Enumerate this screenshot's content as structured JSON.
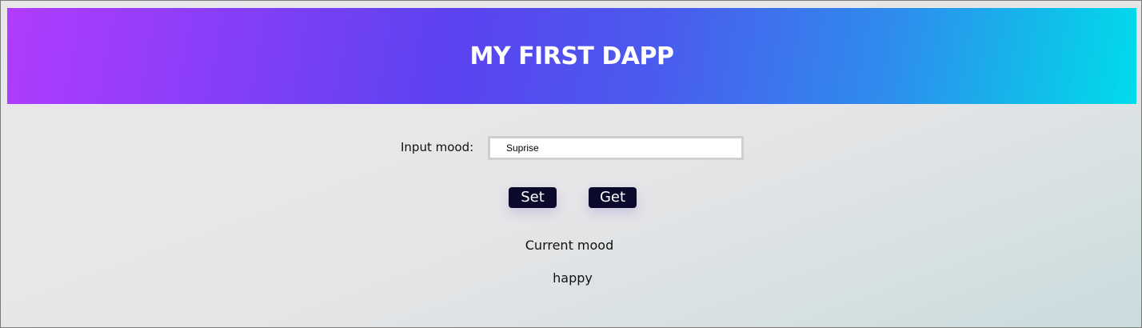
{
  "header": {
    "title": "MY FIRST DAPP"
  },
  "form": {
    "label": "Input mood:",
    "input_value": "Suprise"
  },
  "buttons": {
    "set_label": "Set",
    "get_label": "Get"
  },
  "mood": {
    "heading": "Current mood",
    "value": "happy"
  },
  "colors": {
    "header_gradient_start": "#b13cfd",
    "header_gradient_mid": "#5a43ef",
    "header_gradient_end": "#00dceb",
    "button_bg": "#0b0a2c",
    "button_text": "#ffffff"
  }
}
